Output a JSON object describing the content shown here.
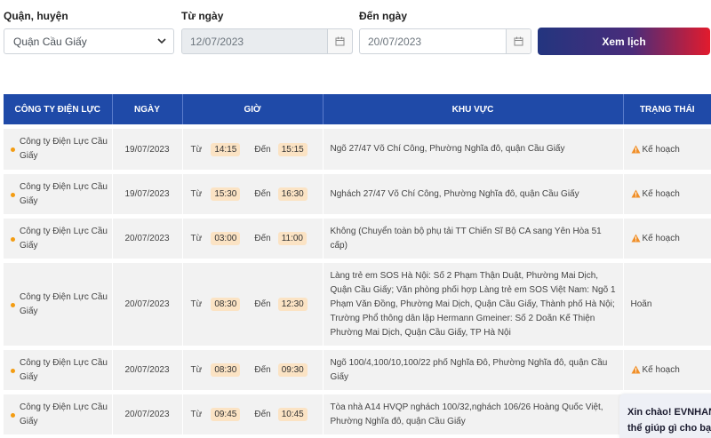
{
  "filters": {
    "district_label": "Quận, huyện",
    "district_value": "Quận Cầu Giấy",
    "from_label": "Từ ngày",
    "from_value": "12/07/2023",
    "to_label": "Đến ngày",
    "to_value": "20/07/2023",
    "button_label": "Xem lịch"
  },
  "table": {
    "headers": [
      "CÔNG TY ĐIỆN LỰC",
      "NGÀY",
      "GIỜ",
      "KHU VỰC",
      "TRẠNG THÁI"
    ],
    "from_word": "Từ",
    "to_word": "Đến",
    "rows": [
      {
        "company": "Công ty Điện Lực Cầu Giấy",
        "date": "19/07/2023",
        "start": "14:15",
        "end": "15:15",
        "area": "Ngõ 27/47 Võ Chí Công, Phường Nghĩa đô, quận Cầu Giấy",
        "status": "Kế hoạch",
        "status_icon": "warning-icon"
      },
      {
        "company": "Công ty Điện Lực Cầu Giấy",
        "date": "19/07/2023",
        "start": "15:30",
        "end": "16:30",
        "area": "Nghách 27/47 Võ Chí Công, Phường Nghĩa đô, quận Cầu Giấy",
        "status": "Kế hoạch",
        "status_icon": "warning-icon"
      },
      {
        "company": "Công ty Điện Lực Cầu Giấy",
        "date": "20/07/2023",
        "start": "03:00",
        "end": "11:00",
        "area": "Không (Chuyển toàn bộ phụ tải TT Chiến Sĩ Bộ CA sang Yên Hòa 51 cấp)",
        "status": "Kế hoạch",
        "status_icon": "warning-icon"
      },
      {
        "company": "Công ty Điện Lực Cầu Giấy",
        "date": "20/07/2023",
        "start": "08:30",
        "end": "12:30",
        "area": "Làng trẻ em SOS Hà Nội: Số 2 Phạm Thận Duật, Phường Mai Dịch, Quận Cầu Giấy; Văn phòng phối hợp Làng trẻ em SOS Việt Nam: Ngõ 1 Phạm Văn Đồng, Phường Mai Dịch, Quận Cầu Giấy, Thành phố Hà Nội; Trường Phổ thông dân lập Hermann Gmeiner: Số 2 Doãn Kế Thiện Phường Mai Dịch, Quận Cầu Giấy, TP Hà Nội",
        "status": "Hoãn",
        "status_icon": ""
      },
      {
        "company": "Công ty Điện Lực Cầu Giấy",
        "date": "20/07/2023",
        "start": "08:30",
        "end": "09:30",
        "area": "Ngõ 100/4,100/10,100/22 phố Nghĩa Đô, Phường Nghĩa đô, quận Cầu Giấy",
        "status": "Kế hoạch",
        "status_icon": "warning-icon"
      },
      {
        "company": "Công ty Điện Lực Cầu Giấy",
        "date": "20/07/2023",
        "start": "09:45",
        "end": "10:45",
        "area": "Tòa nhà A14 HVQP nghách 100/32,nghách 106/26 Hoàng Quốc Việt, Phường Nghĩa đô, quận Cầu Giấy",
        "status": "",
        "status_icon": ""
      }
    ]
  },
  "chat": {
    "line1": "Xin chào! EVNHANOI",
    "line2": "thể giúp gì cho bạn"
  }
}
